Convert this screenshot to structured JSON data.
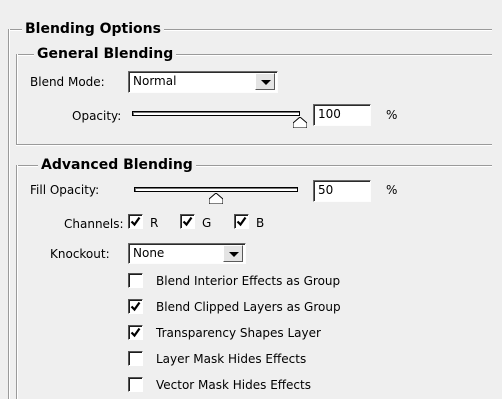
{
  "panel": {
    "title": "Blending Options"
  },
  "general": {
    "title": "General Blending",
    "blend_mode": {
      "label": "Blend Mode:",
      "value": "Normal"
    },
    "opacity": {
      "label": "Opacity:",
      "value": "100",
      "unit": "%",
      "level": 1.0
    }
  },
  "advanced": {
    "title": "Advanced Blending",
    "fill_opacity": {
      "label": "Fill Opacity:",
      "value": "50",
      "unit": "%",
      "level": 0.5
    },
    "channels": {
      "label": "Channels:",
      "items": [
        {
          "label": "R",
          "checked": true
        },
        {
          "label": "G",
          "checked": true
        },
        {
          "label": "B",
          "checked": true
        }
      ]
    },
    "knockout": {
      "label": "Knockout:",
      "value": "None"
    },
    "options": [
      {
        "label": "Blend Interior Effects as Group",
        "checked": false
      },
      {
        "label": "Blend Clipped Layers as Group",
        "checked": true
      },
      {
        "label": "Transparency Shapes Layer",
        "checked": true
      },
      {
        "label": "Layer Mask Hides Effects",
        "checked": false
      },
      {
        "label": "Vector Mask Hides Effects",
        "checked": false
      }
    ]
  }
}
